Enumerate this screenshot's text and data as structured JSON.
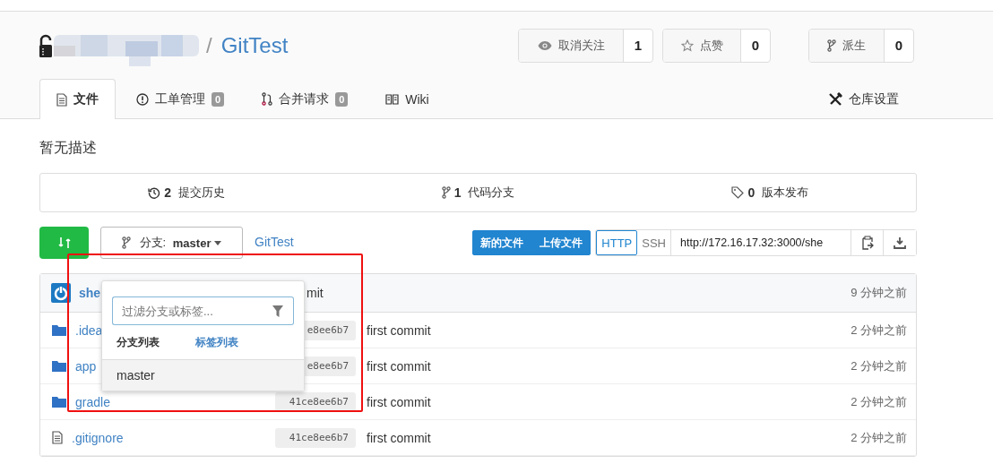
{
  "repo": {
    "separator": "/",
    "name": "GitTest"
  },
  "actions": [
    {
      "kind": "watch",
      "label": "取消关注",
      "count": "1"
    },
    {
      "kind": "star",
      "label": "点赞",
      "count": "0"
    },
    {
      "kind": "fork",
      "label": "派生",
      "count": "0"
    }
  ],
  "tabs": [
    {
      "label": "文件",
      "selected": true
    },
    {
      "label": "工单管理",
      "count": "0",
      "selected": false
    },
    {
      "label": "合并请求",
      "count": "0",
      "selected": false
    },
    {
      "label": "Wiki",
      "selected": false
    }
  ],
  "settings_tab": {
    "label": "仓库设置"
  },
  "description": "暂无描述",
  "stats": [
    {
      "count": "2",
      "label": "提交历史"
    },
    {
      "count": "1",
      "label": "代码分支"
    },
    {
      "count": "0",
      "label": "版本发布"
    }
  ],
  "branch_button": {
    "label": "分支:",
    "branch": "master"
  },
  "repo_link": "GitTest",
  "file_buttons": [
    "新的文件",
    "上传文件"
  ],
  "clone": {
    "protocols": [
      {
        "label": "HTTP",
        "selected": true
      },
      {
        "label": "SSH",
        "selected": false
      }
    ],
    "url": "http://172.16.17.32:3000/she"
  },
  "latest_commit": {
    "author": "she",
    "message": "mit",
    "time": "9 分钟之前"
  },
  "files": [
    {
      "kind": "folder",
      "name": ".idea",
      "sha": "e8ee6b7",
      "message": "first commit",
      "time": "2 分钟之前"
    },
    {
      "kind": "folder",
      "name": "app",
      "sha": "e8ee6b7",
      "message": "first commit",
      "time": "2 分钟之前"
    },
    {
      "kind": "folder",
      "name": "gradle",
      "sha": "41ce8ee6b7",
      "message": "first commit",
      "time": "2 分钟之前"
    },
    {
      "kind": "file",
      "name": ".gitignore",
      "sha": "41ce8ee6b7",
      "message": "first commit",
      "time": "2 分钟之前"
    }
  ],
  "branch_dropdown": {
    "placeholder": "过滤分支或标签...",
    "tabs": [
      {
        "label": "分支列表",
        "selected": true
      },
      {
        "label": "标签列表",
        "selected": false
      }
    ],
    "branches": [
      "master"
    ]
  }
}
